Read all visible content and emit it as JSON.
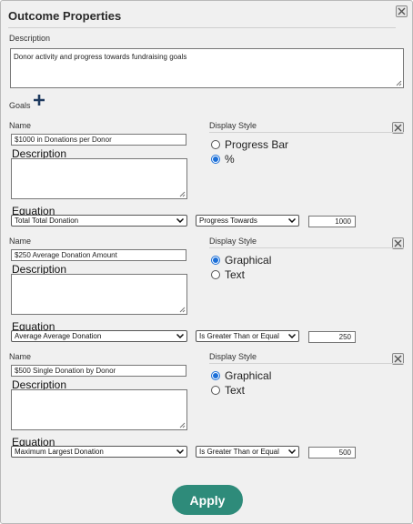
{
  "dialog": {
    "title": "Outcome Properties",
    "description_label": "Description",
    "description_value": "Donor activity and progress towards fundraising goals",
    "goals_label": "Goals",
    "apply_label": "Apply"
  },
  "goal_labels": {
    "name": "Name",
    "display_style": "Display Style",
    "description": "Description",
    "equation": "Equation"
  },
  "goals": [
    {
      "name": "$1000 in Donations per Donor",
      "display_options": [
        "Progress Bar",
        "%"
      ],
      "selected_option": 1,
      "equation_field": "Total Total Donation",
      "operator": "Progress Towards",
      "target": "1000"
    },
    {
      "name": "$250 Average Donation Amount",
      "display_options": [
        "Graphical",
        "Text"
      ],
      "selected_option": 0,
      "equation_field": "Average Average Donation",
      "operator": "Is Greater Than or Equal",
      "target": "250"
    },
    {
      "name": "$500 Single Donation by Donor",
      "display_options": [
        "Graphical",
        "Text"
      ],
      "selected_option": 0,
      "equation_field": "Maximum Largest Donation",
      "operator": "Is Greater Than or Equal",
      "target": "500"
    }
  ],
  "colors": {
    "accent": "#2e8b7a",
    "radio": "#1b6fd8",
    "add_icon": "#1e3a5f"
  }
}
